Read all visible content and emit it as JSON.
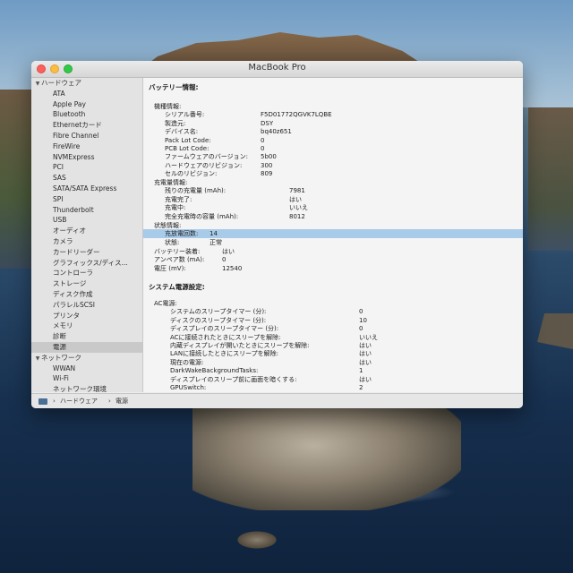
{
  "window": {
    "title": "MacBook Pro"
  },
  "sidebar": {
    "hardware_group": "ハードウェア",
    "hardware_items": [
      "ATA",
      "Apple Pay",
      "Bluetooth",
      "Ethernetカード",
      "Fibre Channel",
      "FireWire",
      "NVMExpress",
      "PCI",
      "SAS",
      "SATA/SATA Express",
      "SPI",
      "Thunderbolt",
      "USB",
      "オーディオ",
      "カメラ",
      "カードリーダー",
      "グラフィックス/ディス...",
      "コントローラ",
      "ストレージ",
      "ディスク作成",
      "パラレルSCSI",
      "プリンタ",
      "メモリ",
      "診断",
      "電源"
    ],
    "network_group": "ネットワーク",
    "network_items": [
      "WWAN",
      "Wi-Fi",
      "ネットワーク環境"
    ]
  },
  "content": {
    "battery_title": "バッテリー情報:",
    "model_info_label": "機種情報:",
    "model_info": [
      {
        "key": "シリアル番号:",
        "value": "F5D01772QGVK7LQBE"
      },
      {
        "key": "製造元:",
        "value": "DSY"
      },
      {
        "key": "デバイス名:",
        "value": "bq40z651"
      },
      {
        "key": "Pack Lot Code:",
        "value": "0"
      },
      {
        "key": "PCB Lot Code:",
        "value": "0"
      },
      {
        "key": "ファームウェアのバージョン:",
        "value": "5b00"
      },
      {
        "key": "ハードウェアのリビジョン:",
        "value": "300"
      },
      {
        "key": "セルのリビジョン:",
        "value": "809"
      }
    ],
    "charge_info_label": "充電量情報:",
    "charge_info": [
      {
        "key": "残りの充電量 (mAh):",
        "value": "7981"
      },
      {
        "key": "充電完了:",
        "value": "はい"
      },
      {
        "key": "充電中:",
        "value": "いいえ"
      },
      {
        "key": "完全充電時の容量 (mAh):",
        "value": "8012"
      }
    ],
    "health_label": "状態情報:",
    "health_info": [
      {
        "key": "充放電回数:",
        "value": "14"
      },
      {
        "key": "状態:",
        "value": "正常"
      }
    ],
    "battery_misc": [
      {
        "key": "バッテリー装着:",
        "value": "はい"
      },
      {
        "key": "アンペア数 (mA):",
        "value": "0"
      },
      {
        "key": "電圧 (mV):",
        "value": "12540"
      }
    ],
    "system_power_title": "システム電源設定:",
    "ac_power_label": "AC電源:",
    "ac_power": [
      {
        "key": "システムのスリープタイマー (分):",
        "value": "0"
      },
      {
        "key": "ディスクのスリープタイマー (分):",
        "value": "10"
      },
      {
        "key": "ディスプレイのスリープタイマー (分):",
        "value": "0"
      },
      {
        "key": "ACに接続されたときにスリープを解除:",
        "value": "いいえ"
      },
      {
        "key": "内蔵ディスプレイが開いたときにスリープを解除:",
        "value": "はい"
      },
      {
        "key": "LANに接続したときにスリープを解除:",
        "value": "はい"
      },
      {
        "key": "現在の電源:",
        "value": "はい"
      },
      {
        "key": "DarkWakeBackgroundTasks:",
        "value": "1"
      },
      {
        "key": "ディスプレイのスリープ前に画面を暗くする:",
        "value": "はい"
      },
      {
        "key": "GPUSwitch:",
        "value": "2"
      }
    ]
  },
  "statusbar": {
    "breadcrumb": [
      "ハードウェア",
      "電源"
    ],
    "separator": "›"
  }
}
